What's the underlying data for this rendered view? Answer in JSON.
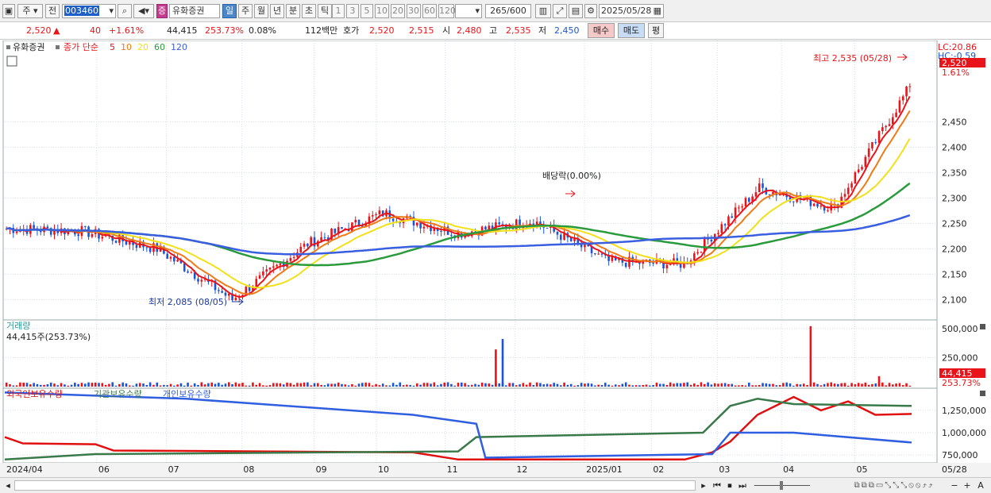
{
  "toolbar": {
    "stock_type": "주",
    "prev_label": "전",
    "code": "003460",
    "sector_badge": "증",
    "stock_name": "유화증권",
    "periods": [
      "일",
      "주",
      "월",
      "년",
      "분",
      "초",
      "틱"
    ],
    "active_period": "일",
    "intervals": [
      "1",
      "3",
      "5",
      "10",
      "20",
      "30",
      "60",
      "120"
    ],
    "count": "265",
    "count_total": "/600",
    "date": "2025/05/28"
  },
  "info": {
    "price": "2,520",
    "change_sign": "▲",
    "change": "40",
    "change_pct": "+1.61%",
    "volume": "44,415",
    "volume_pct": "253.73%",
    "turnover_pct": "0.08%",
    "amount": "112백만",
    "hoga_label": "호가",
    "ask": "2,520",
    "bid": "2,515",
    "open_label": "시",
    "open": "2,480",
    "high_label": "고",
    "high": "2,535",
    "low_label": "저",
    "low": "2,450",
    "buy_label": "매수",
    "sell_label": "매도",
    "avg_label": "평"
  },
  "colors": {
    "up": "#e8141a",
    "down": "#1b55d6",
    "ma5": "#e8141a",
    "ma10": "#f07a14",
    "ma20": "#f2e019",
    "ma60": "#2a9a3c",
    "ma120": "#3a5ee0",
    "foreign": "#e01010",
    "institution": "#3a7a4a",
    "individual": "#2f5fe0"
  },
  "chart_data": [
    {
      "type": "candlestick",
      "title": "유화증권",
      "legend": {
        "label": "종가 단순",
        "periods": [
          "5",
          "10",
          "20",
          "60",
          "120"
        ]
      },
      "ylim": [
        2060,
        2610
      ],
      "y_ticks": [
        "2,450",
        "2,400",
        "2,350",
        "2,300",
        "2,250",
        "2,200",
        "2,150",
        "2,100"
      ],
      "y_tick_values": [
        2450,
        2400,
        2350,
        2300,
        2250,
        2200,
        2150,
        2100
      ],
      "lc_label": "LC:20.86",
      "hc_label": "HC:-0.59",
      "last_price_label": "2,520",
      "last_pct_label": "1.61%",
      "high_annotation": "최고 2,535 (05/28)",
      "low_annotation": "최저 2,085 (08/05)",
      "dividend_annotation": "배당락(0.00%)",
      "ohlc_summary": [
        {
          "date": "2024/04",
          "close": 2240
        },
        {
          "date": "2024/06",
          "close": 2235
        },
        {
          "date": "2024/07",
          "close": 2200
        },
        {
          "date": "2024/08",
          "close": 2100
        },
        {
          "date": "2024/09",
          "close": 2210
        },
        {
          "date": "2024/10",
          "close": 2270
        },
        {
          "date": "2024/11",
          "close": 2230
        },
        {
          "date": "2024/12",
          "close": 2255
        },
        {
          "date": "2025/01",
          "close": 2175
        },
        {
          "date": "2025/02",
          "close": 2170
        },
        {
          "date": "2025/03",
          "close": 2320
        },
        {
          "date": "2025/04",
          "close": 2280
        },
        {
          "date": "2025/05",
          "close": 2520
        }
      ],
      "ma120": [
        [
          2240,
          0
        ],
        [
          2262,
          0.1
        ],
        [
          2215,
          0.3
        ],
        [
          2230,
          0.45
        ],
        [
          2205,
          0.55
        ],
        [
          2220,
          0.7
        ],
        [
          2228,
          0.8
        ],
        [
          2285,
          1.0
        ]
      ]
    },
    {
      "type": "bar",
      "title": "거래량",
      "value_label": "44,415주(253.73%)",
      "y_ticks": [
        "500,000",
        "250,000"
      ],
      "y_tick_values": [
        500000,
        250000
      ],
      "last_label": "44,415",
      "last_pct_label": "253.73%",
      "ylim": [
        0,
        560000
      ],
      "spikes": [
        {
          "date": "2024/11",
          "value": 410000,
          "dir": "down"
        },
        {
          "date": "2024/11",
          "value": 320000,
          "dir": "up"
        },
        {
          "date": "2025/03",
          "value": 520000,
          "dir": "up"
        },
        {
          "date": "2025/05",
          "value": 90000,
          "dir": "up"
        }
      ]
    },
    {
      "type": "line",
      "legend": [
        "외국인보유수량",
        "기관보유수량",
        "개인보유수량"
      ],
      "y_ticks": [
        "1,250,000",
        "1,000,000",
        "750,000"
      ],
      "y_tick_values": [
        1250000,
        1000000,
        750000
      ],
      "ylim": [
        680000,
        1480000
      ],
      "series": [
        {
          "name": "외국인보유수량",
          "values": [
            [
              0,
              950000
            ],
            [
              0.02,
              880000
            ],
            [
              0.1,
              870000
            ],
            [
              0.12,
              800000
            ],
            [
              0.45,
              780000
            ],
            [
              0.5,
              700000
            ],
            [
              0.75,
              700000
            ],
            [
              0.78,
              780000
            ],
            [
              0.8,
              900000
            ],
            [
              0.83,
              1200000
            ],
            [
              0.87,
              1400000
            ],
            [
              0.9,
              1250000
            ],
            [
              0.93,
              1350000
            ],
            [
              0.96,
              1200000
            ],
            [
              1,
              1210000
            ]
          ]
        },
        {
          "name": "기관보유수량",
          "values": [
            [
              0,
              700000
            ],
            [
              0.1,
              760000
            ],
            [
              0.5,
              790000
            ],
            [
              0.52,
              950000
            ],
            [
              0.77,
              1000000
            ],
            [
              0.8,
              1300000
            ],
            [
              0.83,
              1380000
            ],
            [
              0.87,
              1320000
            ],
            [
              1,
              1300000
            ]
          ]
        },
        {
          "name": "개인보유수량",
          "values": [
            [
              0,
              1450000
            ],
            [
              0.2,
              1380000
            ],
            [
              0.45,
              1200000
            ],
            [
              0.52,
              1100000
            ],
            [
              0.53,
              720000
            ],
            [
              0.78,
              760000
            ],
            [
              0.8,
              1000000
            ],
            [
              0.87,
              1000000
            ],
            [
              1,
              890000
            ]
          ]
        }
      ]
    }
  ],
  "x_axis": [
    "2024/04",
    "06",
    "07",
    "08",
    "09",
    "10",
    "11",
    "12",
    "2025/01",
    "02",
    "03",
    "04",
    "05",
    "05/28"
  ],
  "scroll_glyphs": [
    "◂",
    "▸",
    "⏮",
    "⏹",
    "⏭"
  ],
  "zoom_glyphs": [
    "−",
    "+",
    "A"
  ]
}
